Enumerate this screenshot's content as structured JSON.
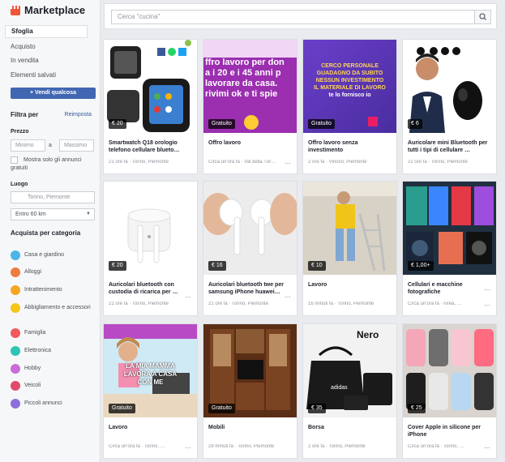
{
  "app": {
    "title": "Marketplace"
  },
  "sidebar": {
    "nav": [
      "Sfoglia",
      "Acquisto",
      "In vendita",
      "Elementi salvati"
    ],
    "sell_button": "+ Vendi qualcosa",
    "filter_title": "Filtra per",
    "reset_label": "Reimposta",
    "price_label": "Prezzo",
    "min_placeholder": "Minimo",
    "separator": "a",
    "max_placeholder": "Massimo",
    "checkbox_label": "Mostra solo gli annunci gratuiti",
    "location_label": "Luogo",
    "location_value": "Torino, Piemonte",
    "distance_value": "Entro 60 km",
    "categories_title": "Acquista per categoria",
    "categories": [
      {
        "label": "Casa e giardino",
        "color": "#4cb5e8"
      },
      {
        "label": "Alloggi",
        "color": "#f07b3f"
      },
      {
        "label": "Intrattenimento",
        "color": "#f5a623"
      },
      {
        "label": "Abbigliamento e accessori",
        "color": "#f5c518"
      },
      {
        "label": "Famiglia",
        "color": "#f05a5a"
      },
      {
        "label": "Elettronica",
        "color": "#2ec4b6"
      },
      {
        "label": "Hobby",
        "color": "#c86dd7"
      },
      {
        "label": "Veicoli",
        "color": "#e24b6b"
      },
      {
        "label": "Piccoli annunci",
        "color": "#8b6fdb"
      }
    ]
  },
  "search": {
    "placeholder": "Cerca \"cucina\""
  },
  "listings": [
    {
      "price": "€ 20",
      "title": "Smartwatch Q18 orologio telefono cellulare blueto…",
      "meta": "21 ore fa · Torino, Piemonte"
    },
    {
      "price": "Gratuito",
      "title": "Offro lavoro",
      "meta": "Circa un'ora fa · Val della Tòr…"
    },
    {
      "price": "Gratuito",
      "title": "Offro lavoro senza investimento",
      "meta": "2 ore fa · Vinovo, Piemonte"
    },
    {
      "price": "€ 6",
      "title": "Auricolare mini Bluetooth per tutti i tipi di cellulare …",
      "meta": "22 ore fa · Torino, Piemonte"
    },
    {
      "price": "€ 20",
      "title": "Auricolari bluetooth con custodia di ricarica per …",
      "meta": "21 ore fa · Torino, Piemonte"
    },
    {
      "price": "€ 16",
      "title": "Auricolari bluetooth twe per samsung iPhone huawei…",
      "meta": "21 ore fa · Torino, Piemonte"
    },
    {
      "price": "€ 10",
      "title": "Lavoro",
      "meta": "16 minuti fa · Torino, Piemonte"
    },
    {
      "price": "€ 1,00+",
      "title": "Cellulari e macchine fotografiche",
      "meta": "Circa un'ora fa · Ivrea, …"
    },
    {
      "price": "Gratuito",
      "title": "Lavoro",
      "meta": "Circa un'ora fa · Torino, …"
    },
    {
      "price": "Gratuito",
      "title": "Mobili",
      "meta": "29 minuti fa · Torino, Piemonte"
    },
    {
      "price": "€ 35",
      "title": "Borsa",
      "meta": "2 ore fa · Torino, Piemonte"
    },
    {
      "price": "€ 25",
      "title": "Cover Apple in silicone per iPhone",
      "meta": "Circa un'ora fa · Torino, …"
    }
  ],
  "banners": {
    "job1": [
      "ffro lavoro per don",
      "a i 20 e i 45 anni p",
      "lavorare da casa.",
      "rivimi ok e ti spie"
    ],
    "job2": [
      "CERCO PERSONALE",
      "GUADAGNO DA SUBITO",
      "NESSUN INVESTIMENTO",
      "IL MATERIALE DI LAVORO",
      "te lo fornisco io"
    ],
    "mom": [
      "LA MIA MAMMA",
      "LAVORA A CASA",
      "CON ME"
    ],
    "bag": "Nero"
  },
  "more_dots": "…"
}
